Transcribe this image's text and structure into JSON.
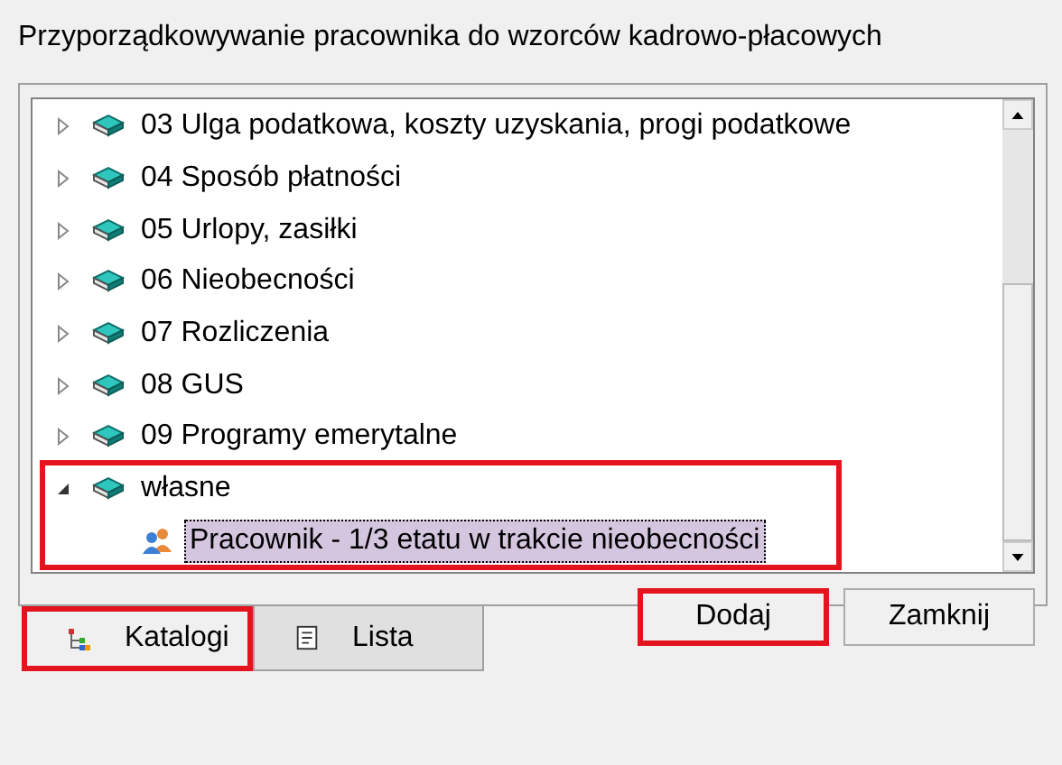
{
  "window": {
    "title": "Przyporządkowywanie pracownika do wzorców kadrowo-płacowych"
  },
  "tree": [
    {
      "label": "03 Ulga podatkowa, koszty uzyskania, progi podatkowe",
      "kind": "folder",
      "expanded": false,
      "highlighted": false
    },
    {
      "label": "04 Sposób płatności",
      "kind": "folder",
      "expanded": false,
      "highlighted": false
    },
    {
      "label": "05 Urlopy, zasiłki",
      "kind": "folder",
      "expanded": false,
      "highlighted": false
    },
    {
      "label": "06 Nieobecności",
      "kind": "folder",
      "expanded": false,
      "highlighted": false
    },
    {
      "label": "07 Rozliczenia",
      "kind": "folder",
      "expanded": false,
      "highlighted": false
    },
    {
      "label": "08 GUS",
      "kind": "folder",
      "expanded": false,
      "highlighted": false
    },
    {
      "label": "09 Programy emerytalne",
      "kind": "folder",
      "expanded": false,
      "highlighted": false
    },
    {
      "label": "własne",
      "kind": "folder",
      "expanded": true,
      "highlighted": true,
      "children": [
        {
          "label": "Pracownik - 1/3 etatu w trakcie nieobecności",
          "kind": "template",
          "selected": true
        }
      ]
    }
  ],
  "buttons": [
    {
      "label": "Dodaj",
      "highlighted": true
    },
    {
      "label": "Zamknij",
      "highlighted": false
    }
  ],
  "tabs": [
    {
      "label": "Katalogi",
      "kind": "tree",
      "selected": true,
      "highlighted": true
    },
    {
      "label": "Lista",
      "kind": "list",
      "selected": false,
      "highlighted": false
    }
  ]
}
